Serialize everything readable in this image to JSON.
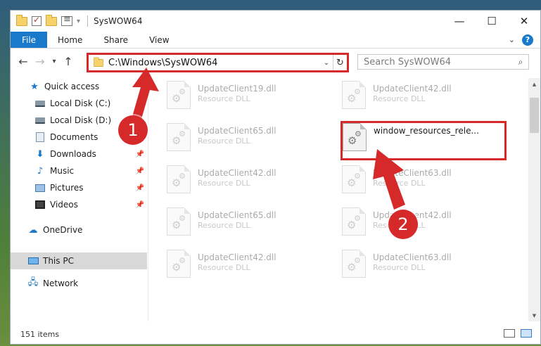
{
  "window": {
    "title": "SysWOW64",
    "controls": {
      "minimize": "—",
      "maximize": "☐",
      "close": "✕"
    }
  },
  "ribbon": {
    "tabs": [
      "File",
      "Home",
      "Share",
      "View"
    ],
    "help": "?"
  },
  "address": {
    "path": "C:\\Windows\\SysWOW64",
    "search_placeholder": "Search SysWOW64"
  },
  "sidebar": {
    "items": [
      {
        "label": "Quick access",
        "icon": "star-icon",
        "pinned": false,
        "selected": false
      },
      {
        "label": "Local Disk (C:)",
        "icon": "drive-icon",
        "pinned": false,
        "selected": false
      },
      {
        "label": "Local Disk (D:)",
        "icon": "drive-icon",
        "pinned": false,
        "selected": false
      },
      {
        "label": "Documents",
        "icon": "documents-icon",
        "pinned": false,
        "selected": false
      },
      {
        "label": "Downloads",
        "icon": "download-icon",
        "pinned": true,
        "selected": false
      },
      {
        "label": "Music",
        "icon": "music-icon",
        "pinned": true,
        "selected": false
      },
      {
        "label": "Pictures",
        "icon": "pictures-icon",
        "pinned": true,
        "selected": false
      },
      {
        "label": "Videos",
        "icon": "videos-icon",
        "pinned": true,
        "selected": false
      },
      {
        "label": "OneDrive",
        "icon": "onedrive-icon",
        "pinned": false,
        "selected": false
      },
      {
        "label": "This PC",
        "icon": "this-pc-icon",
        "pinned": false,
        "selected": true
      },
      {
        "label": "Network",
        "icon": "network-icon",
        "pinned": false,
        "selected": false
      }
    ]
  },
  "files": [
    {
      "name": "UpdateClient19.dll",
      "type": "Resource DLL",
      "faded": true
    },
    {
      "name": "UpdateClient42.dll",
      "type": "Resource DLL",
      "faded": true
    },
    {
      "name": "UpdateClient65.dll",
      "type": "Resource DLL",
      "faded": true
    },
    {
      "name": "window_resources_rele...",
      "type": "",
      "faded": false,
      "highlighted": true
    },
    {
      "name": "UpdateClient42.dll",
      "type": "Resource DLL",
      "faded": true
    },
    {
      "name": "UpdateClient63.dll",
      "type": "Resource DLL",
      "faded": true
    },
    {
      "name": "UpdateClient65.dll",
      "type": "Resource DLL",
      "faded": true
    },
    {
      "name": "UpdateClient42.dll",
      "type": "Resource DLL",
      "faded": true
    },
    {
      "name": "UpdateClient42.dll",
      "type": "Resource DLL",
      "faded": true
    },
    {
      "name": "UpdateClient63.dll",
      "type": "Resource DLL",
      "faded": true
    }
  ],
  "status": {
    "item_count": "151 items"
  },
  "annotations": {
    "step1": "1",
    "step2": "2",
    "color": "#d62a2a"
  }
}
